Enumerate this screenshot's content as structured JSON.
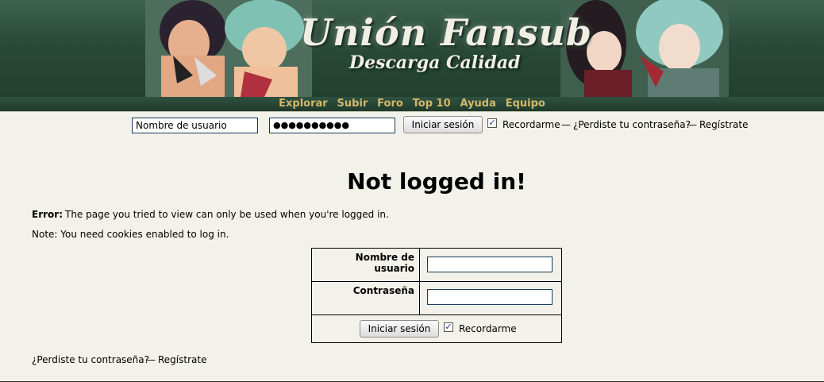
{
  "banner": {
    "title": "Unión Fansub",
    "subtitle": "Descarga Calidad"
  },
  "nav": {
    "items": [
      "Explorar",
      "Subir",
      "Foro",
      "Top 10",
      "Ayuda",
      "Equipo"
    ]
  },
  "topbar": {
    "username_value": "Nombre de usuario",
    "password_value": "●●●●●●●●●●",
    "login_button": "Iniciar sesión",
    "remember_checked": true,
    "remember_label": "Recordarme",
    "separator1": "—",
    "forgot_link": "¿Perdiste tu contraseña?",
    "separator2": "—",
    "register_link": "Regístrate"
  },
  "main": {
    "heading": "Not logged in!",
    "error_label": "Error:",
    "error_text": "The page you tried to view can only be used when you're logged in.",
    "note_text": "Note: You need cookies enabled to log in.",
    "form": {
      "username_label": "Nombre de usuario",
      "password_label": "Contraseña",
      "username_value": "",
      "password_value": "",
      "login_button": "Iniciar sesión",
      "remember_checked": true,
      "remember_label": "Recordarme"
    },
    "footer": {
      "forgot_link": "¿Perdiste tu contraseña?",
      "separator": "—",
      "register_link": "Regístrate"
    }
  }
}
